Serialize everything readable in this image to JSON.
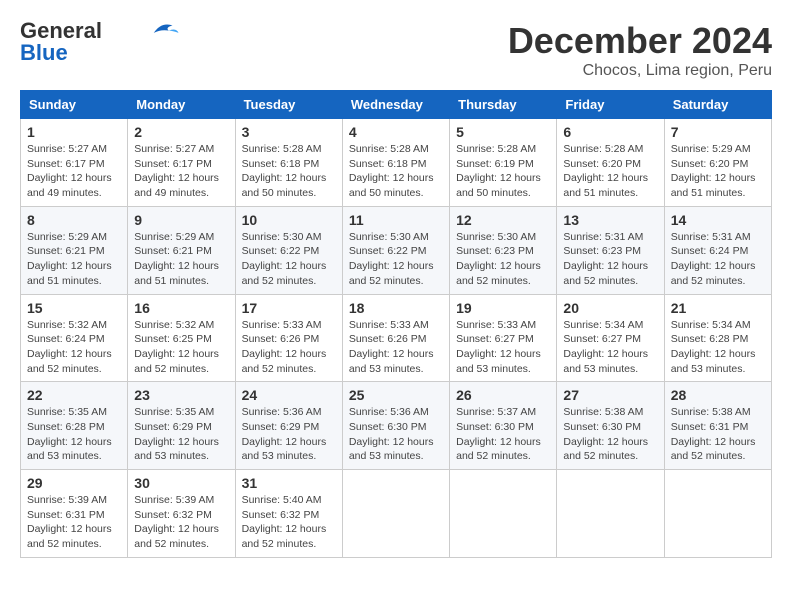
{
  "header": {
    "logo_general": "General",
    "logo_blue": "Blue",
    "month": "December 2024",
    "location": "Chocos, Lima region, Peru"
  },
  "weekdays": [
    "Sunday",
    "Monday",
    "Tuesday",
    "Wednesday",
    "Thursday",
    "Friday",
    "Saturday"
  ],
  "weeks": [
    [
      {
        "day": "1",
        "sunrise": "5:27 AM",
        "sunset": "6:17 PM",
        "daylight": "12 hours and 49 minutes."
      },
      {
        "day": "2",
        "sunrise": "5:27 AM",
        "sunset": "6:17 PM",
        "daylight": "12 hours and 49 minutes."
      },
      {
        "day": "3",
        "sunrise": "5:28 AM",
        "sunset": "6:18 PM",
        "daylight": "12 hours and 50 minutes."
      },
      {
        "day": "4",
        "sunrise": "5:28 AM",
        "sunset": "6:18 PM",
        "daylight": "12 hours and 50 minutes."
      },
      {
        "day": "5",
        "sunrise": "5:28 AM",
        "sunset": "6:19 PM",
        "daylight": "12 hours and 50 minutes."
      },
      {
        "day": "6",
        "sunrise": "5:28 AM",
        "sunset": "6:20 PM",
        "daylight": "12 hours and 51 minutes."
      },
      {
        "day": "7",
        "sunrise": "5:29 AM",
        "sunset": "6:20 PM",
        "daylight": "12 hours and 51 minutes."
      }
    ],
    [
      {
        "day": "8",
        "sunrise": "5:29 AM",
        "sunset": "6:21 PM",
        "daylight": "12 hours and 51 minutes."
      },
      {
        "day": "9",
        "sunrise": "5:29 AM",
        "sunset": "6:21 PM",
        "daylight": "12 hours and 51 minutes."
      },
      {
        "day": "10",
        "sunrise": "5:30 AM",
        "sunset": "6:22 PM",
        "daylight": "12 hours and 52 minutes."
      },
      {
        "day": "11",
        "sunrise": "5:30 AM",
        "sunset": "6:22 PM",
        "daylight": "12 hours and 52 minutes."
      },
      {
        "day": "12",
        "sunrise": "5:30 AM",
        "sunset": "6:23 PM",
        "daylight": "12 hours and 52 minutes."
      },
      {
        "day": "13",
        "sunrise": "5:31 AM",
        "sunset": "6:23 PM",
        "daylight": "12 hours and 52 minutes."
      },
      {
        "day": "14",
        "sunrise": "5:31 AM",
        "sunset": "6:24 PM",
        "daylight": "12 hours and 52 minutes."
      }
    ],
    [
      {
        "day": "15",
        "sunrise": "5:32 AM",
        "sunset": "6:24 PM",
        "daylight": "12 hours and 52 minutes."
      },
      {
        "day": "16",
        "sunrise": "5:32 AM",
        "sunset": "6:25 PM",
        "daylight": "12 hours and 52 minutes."
      },
      {
        "day": "17",
        "sunrise": "5:33 AM",
        "sunset": "6:26 PM",
        "daylight": "12 hours and 52 minutes."
      },
      {
        "day": "18",
        "sunrise": "5:33 AM",
        "sunset": "6:26 PM",
        "daylight": "12 hours and 53 minutes."
      },
      {
        "day": "19",
        "sunrise": "5:33 AM",
        "sunset": "6:27 PM",
        "daylight": "12 hours and 53 minutes."
      },
      {
        "day": "20",
        "sunrise": "5:34 AM",
        "sunset": "6:27 PM",
        "daylight": "12 hours and 53 minutes."
      },
      {
        "day": "21",
        "sunrise": "5:34 AM",
        "sunset": "6:28 PM",
        "daylight": "12 hours and 53 minutes."
      }
    ],
    [
      {
        "day": "22",
        "sunrise": "5:35 AM",
        "sunset": "6:28 PM",
        "daylight": "12 hours and 53 minutes."
      },
      {
        "day": "23",
        "sunrise": "5:35 AM",
        "sunset": "6:29 PM",
        "daylight": "12 hours and 53 minutes."
      },
      {
        "day": "24",
        "sunrise": "5:36 AM",
        "sunset": "6:29 PM",
        "daylight": "12 hours and 53 minutes."
      },
      {
        "day": "25",
        "sunrise": "5:36 AM",
        "sunset": "6:30 PM",
        "daylight": "12 hours and 53 minutes."
      },
      {
        "day": "26",
        "sunrise": "5:37 AM",
        "sunset": "6:30 PM",
        "daylight": "12 hours and 52 minutes."
      },
      {
        "day": "27",
        "sunrise": "5:38 AM",
        "sunset": "6:30 PM",
        "daylight": "12 hours and 52 minutes."
      },
      {
        "day": "28",
        "sunrise": "5:38 AM",
        "sunset": "6:31 PM",
        "daylight": "12 hours and 52 minutes."
      }
    ],
    [
      {
        "day": "29",
        "sunrise": "5:39 AM",
        "sunset": "6:31 PM",
        "daylight": "12 hours and 52 minutes."
      },
      {
        "day": "30",
        "sunrise": "5:39 AM",
        "sunset": "6:32 PM",
        "daylight": "12 hours and 52 minutes."
      },
      {
        "day": "31",
        "sunrise": "5:40 AM",
        "sunset": "6:32 PM",
        "daylight": "12 hours and 52 minutes."
      },
      null,
      null,
      null,
      null
    ]
  ]
}
